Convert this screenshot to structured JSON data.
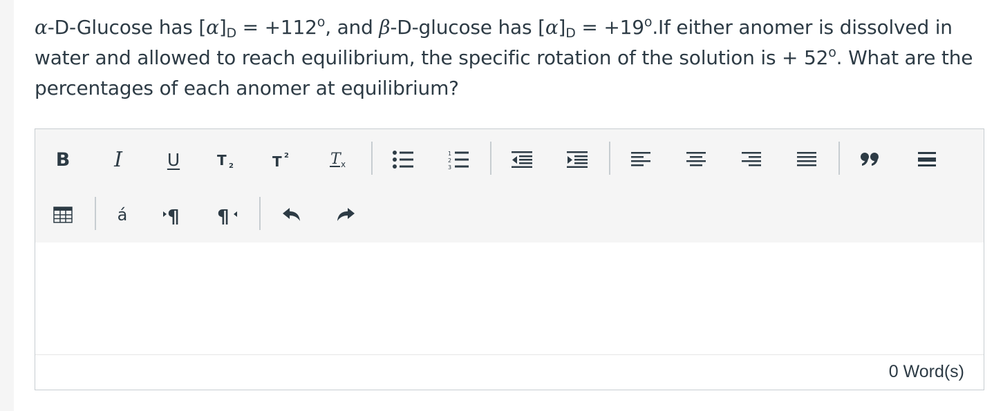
{
  "question": {
    "alpha_symbol": "α",
    "part1": "-D-Glucose has [",
    "alpha_symbol2": "α",
    "bracket_close": "]",
    "sub_d": "D",
    "part2": " = +112",
    "deg": "o",
    "part3": ", and ",
    "beta_symbol": "β",
    "part4": "-D-glucose has [",
    "alpha_symbol3": "α",
    "bracket_close2": "]",
    "sub_d2": "D",
    "part5": " = +19",
    "deg2": "o",
    "part6": ".If either anomer is dissolved in water and allowed to reach equilibrium, the specific rotation of the solution is + 52",
    "deg3": "o",
    "part7": ". What are the percentages of each anomer at equilibrium?"
  },
  "toolbar": {
    "bold_label": "B",
    "italic_label": "I",
    "underline_label": "U",
    "accent_label": "á",
    "icons": [
      "bold-icon",
      "italic-icon",
      "underline-icon",
      "subscript-icon",
      "superscript-icon",
      "clear-formatting-icon",
      "bullet-list-icon",
      "numbered-list-icon",
      "outdent-icon",
      "indent-icon",
      "align-left-icon",
      "align-center-icon",
      "align-right-icon",
      "align-justify-icon",
      "blockquote-icon",
      "horizontal-rule-icon",
      "table-icon",
      "special-char-icon",
      "ltr-icon",
      "rtl-icon",
      "undo-icon",
      "redo-icon"
    ]
  },
  "editor": {
    "content": "",
    "word_count": "0 Word(s)"
  }
}
